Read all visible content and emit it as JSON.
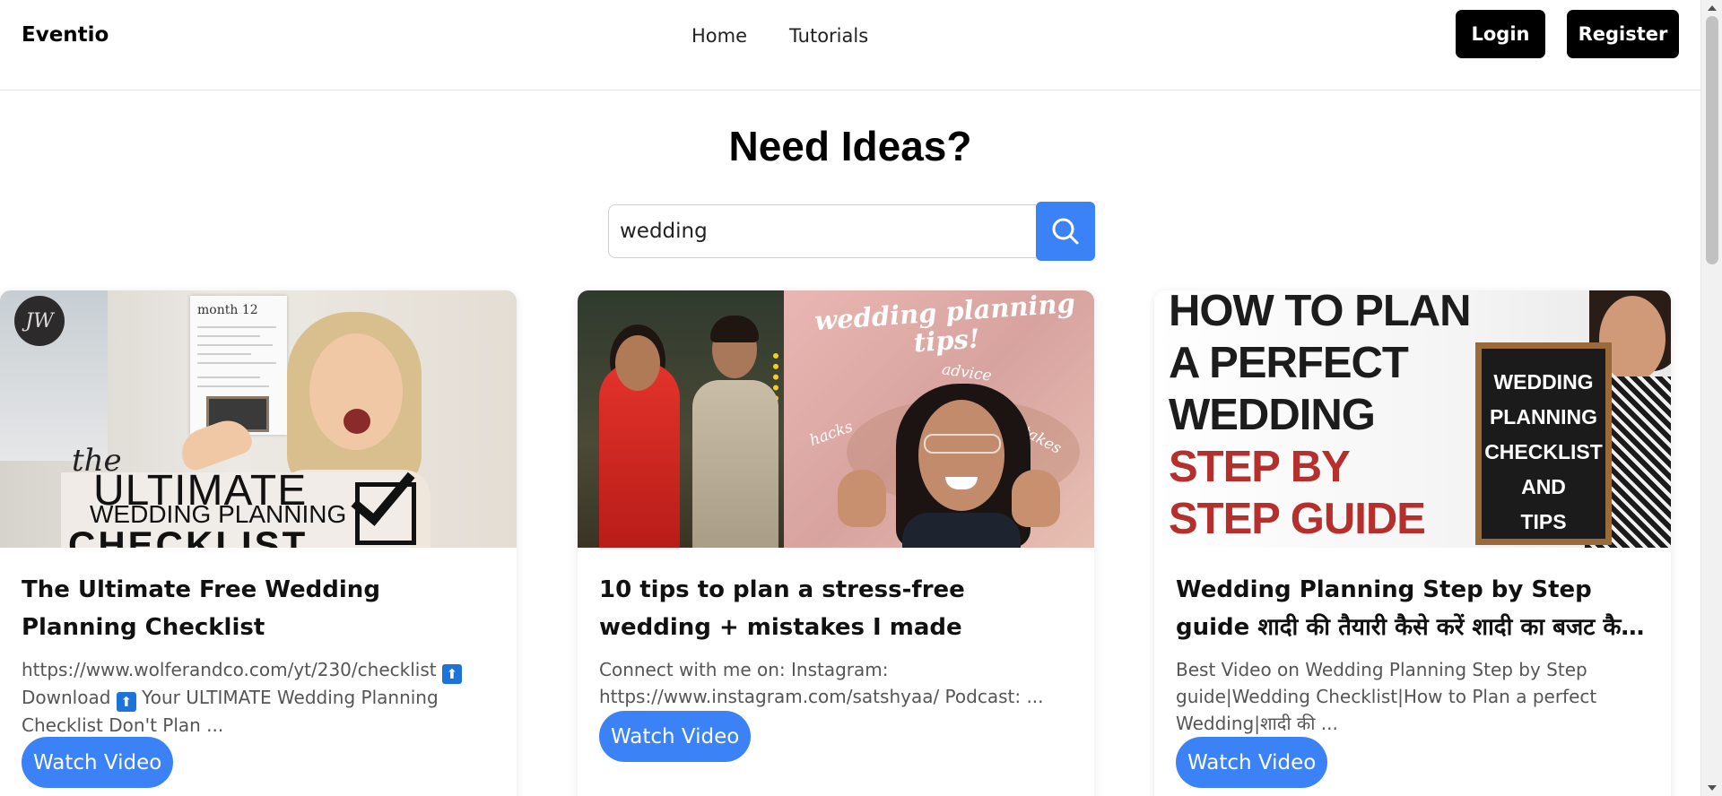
{
  "header": {
    "brand": "Eventio",
    "nav": [
      "Home",
      "Tutorials"
    ],
    "login_label": "Login",
    "register_label": "Register"
  },
  "hero": {
    "title": "Need Ideas?",
    "search_value": "wedding",
    "search_icon": "search-icon"
  },
  "colors": {
    "accent": "#3b82f6",
    "dark_button": "#000000"
  },
  "cards": [
    {
      "title": "The Ultimate Free Wedding Planning Checklist",
      "desc_line1": "https://www.wolferandco.com/yt/230/checklist",
      "desc_line2a": "Download",
      "desc_line2b": "Your ULTIMATE Wedding Planning",
      "desc_line3": "Checklist Don't Plan ...",
      "badge": "⬆",
      "watch_label": "Watch Video",
      "thumb": {
        "logo": "JW",
        "sheet_title": "month 12",
        "the": "the",
        "big": "ULTIMATE",
        "sub": "WEDDING PLANNING",
        "bottom": "CHECKLIST"
      }
    },
    {
      "title": "10 tips to plan a stress-free wedding + mistakes I made",
      "desc_line1": "Connect with me on: Instagram:",
      "desc_line2": "https://www.instagram.com/satshyaa/ Podcast: ...",
      "watch_label": "Watch Video",
      "thumb": {
        "line1": "wedding planning",
        "line2": "tips!",
        "w1": "advice",
        "w2": "hacks",
        "w3": "mistakes"
      }
    },
    {
      "title": "Wedding Planning Step by Step guide शादी की तैयारी कैसे करें शादी का बजट कैसे बनाए...",
      "desc_line1": "Best Video on Wedding Planning Step by Step",
      "desc_line2": "guide|Wedding Checklist|How to Plan a perfect",
      "desc_line3": "Wedding|शादी की ...",
      "watch_label": "Watch Video",
      "thumb": {
        "l1": "HOW TO PLAN",
        "l2": "A PERFECT",
        "l3": "WEDDING",
        "l4": "STEP BY",
        "l5": "STEP GUIDE",
        "b1": "WEDDING",
        "b2": "PLANNING",
        "b3": "CHECKLIST",
        "b4": "AND",
        "b5": "TIPS"
      }
    }
  ]
}
